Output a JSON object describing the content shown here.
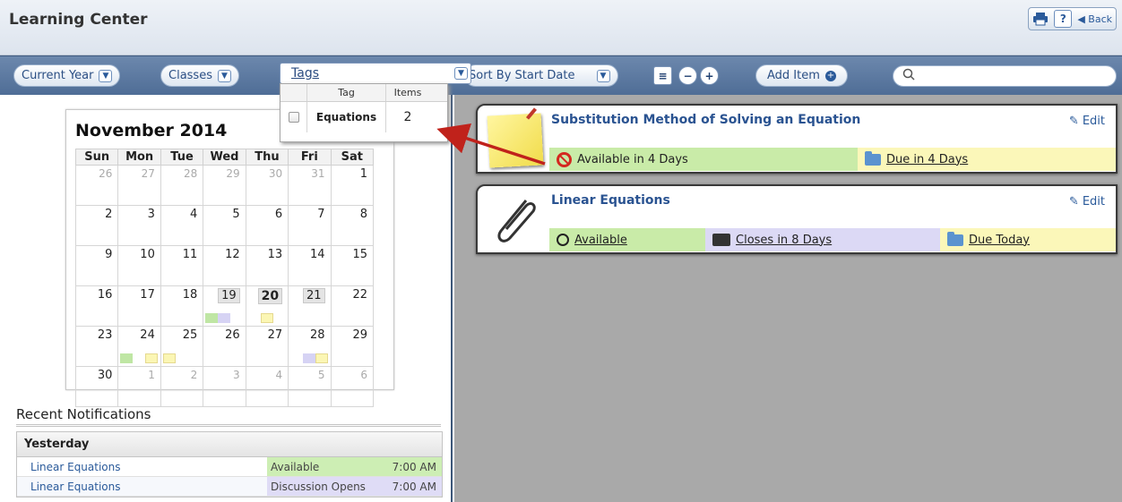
{
  "header": {
    "title": "Learning Center",
    "back_label": "Back",
    "help_label": "?"
  },
  "filters": {
    "year": "Current Year",
    "classes": "Classes",
    "tags": "Tags",
    "sort": "Sort By Start Date",
    "add_item": "Add Item"
  },
  "tags_popup": {
    "col_tag": "Tag",
    "col_items": "Items",
    "rows": [
      {
        "tag": "Equations",
        "items": "2"
      }
    ]
  },
  "calendar": {
    "title": "November 2014",
    "weekdays": [
      "Sun",
      "Mon",
      "Tue",
      "Wed",
      "Thu",
      "Fri",
      "Sat"
    ],
    "weeks": [
      [
        "26",
        "27",
        "28",
        "29",
        "30",
        "31",
        "1"
      ],
      [
        "2",
        "3",
        "4",
        "5",
        "6",
        "7",
        "8"
      ],
      [
        "9",
        "10",
        "11",
        "12",
        "13",
        "14",
        "15"
      ],
      [
        "16",
        "17",
        "18",
        "19",
        "20",
        "21",
        "22"
      ],
      [
        "23",
        "24",
        "25",
        "26",
        "27",
        "28",
        "29"
      ],
      [
        "30",
        "1",
        "2",
        "3",
        "4",
        "5",
        "6"
      ]
    ]
  },
  "notifications": {
    "title": "Recent Notifications",
    "group": "Yesterday",
    "rows": [
      {
        "item": "Linear Equations",
        "status": "Available",
        "time": "7:00 AM"
      },
      {
        "item": "Linear Equations",
        "status": "Discussion Opens",
        "time": "7:00 AM"
      }
    ]
  },
  "items": [
    {
      "title": "Substitution Method of Solving an Equation",
      "edit": "Edit",
      "status1": "Available in 4 Days",
      "status2": "Due in 4 Days"
    },
    {
      "title": "Linear Equations",
      "edit": "Edit",
      "status1": "Available",
      "status2": "Closes in 8 Days",
      "status3": "Due Today"
    }
  ],
  "colors": {
    "accent": "#2a5391",
    "toolbar": "#5d7aa2",
    "available": "#c9eba8",
    "due": "#fbf7b9",
    "discussion": "#dcd9f5",
    "arrow": "#c0221b"
  }
}
